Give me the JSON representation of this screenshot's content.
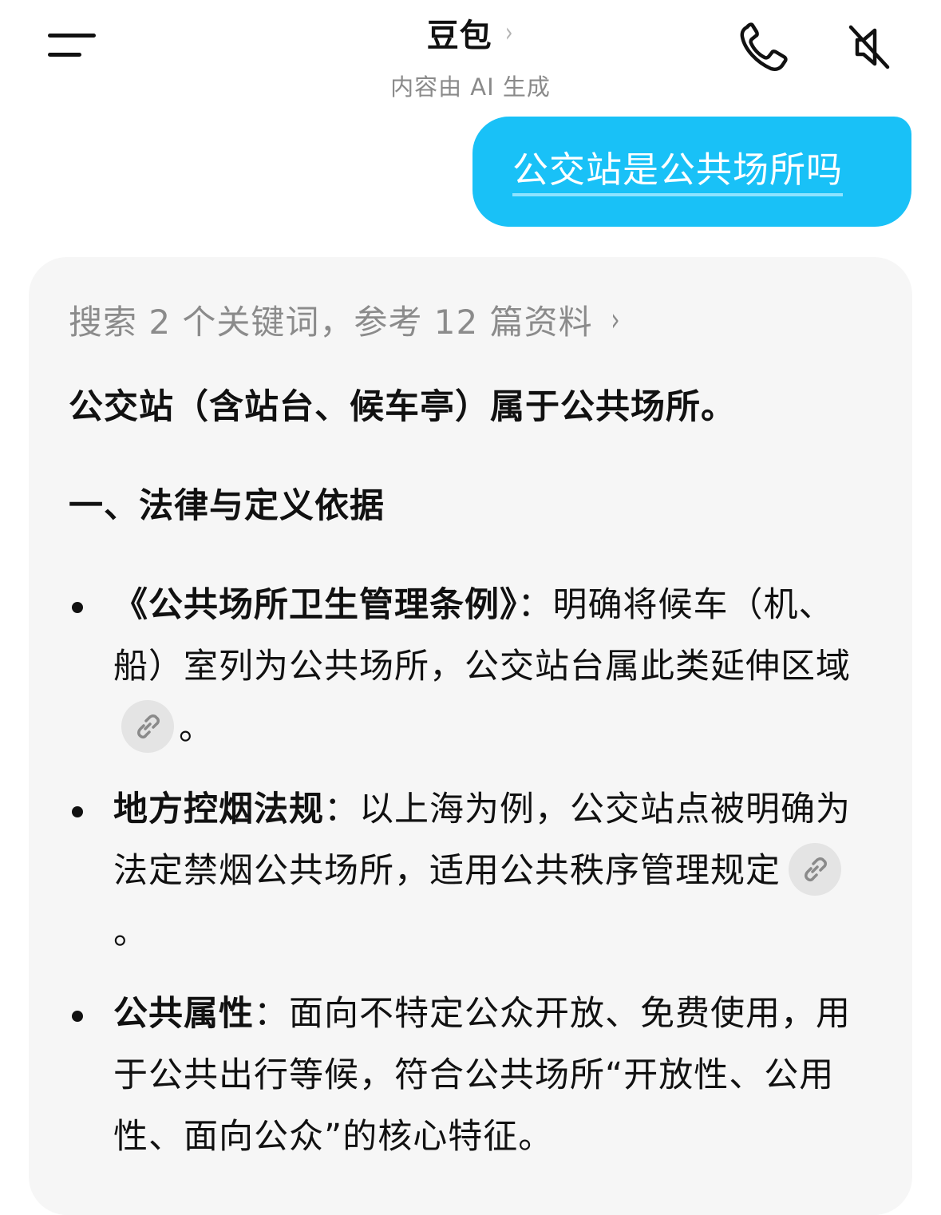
{
  "header": {
    "title": "豆包",
    "title_chevron": "›",
    "subtitle": "内容由 AI 生成",
    "menu_icon": "menu-icon",
    "call_icon": "phone-icon",
    "mute_icon": "speaker-muted-icon"
  },
  "user_message": {
    "text": "公交站是公共场所吗"
  },
  "bot_message": {
    "search_summary": "搜索 2 个关键词，参考 12 篇资料",
    "search_chevron": "›",
    "lead": "公交站（含站台、候车亭）属于公共场所。",
    "section_title": "一、法律与定义依据",
    "bullets": [
      {
        "bold": "《公共场所卫生管理条例》",
        "colon": "：",
        "text": "明确将候车（机、船）室列为公共场所，公交站台属此类延伸区域",
        "end": "。",
        "has_link": true
      },
      {
        "bold": "地方控烟法规",
        "colon": "：",
        "text": "以上海为例，公交站点被明确为法定禁烟公共场所，适用公共秩序管理规定",
        "end": "。",
        "has_link": true
      },
      {
        "bold": "公共属性",
        "colon": "：",
        "text": "面向不特定公众开放、免费使用，用于公共出行等候，符合公共场所“开放性、公用性、面向公众”的核心特征。",
        "end": "",
        "has_link": false
      }
    ]
  },
  "colors": {
    "user_bubble": "#19c1f7",
    "card_bg": "#f6f6f6",
    "muted_text": "#8b8b8b"
  }
}
